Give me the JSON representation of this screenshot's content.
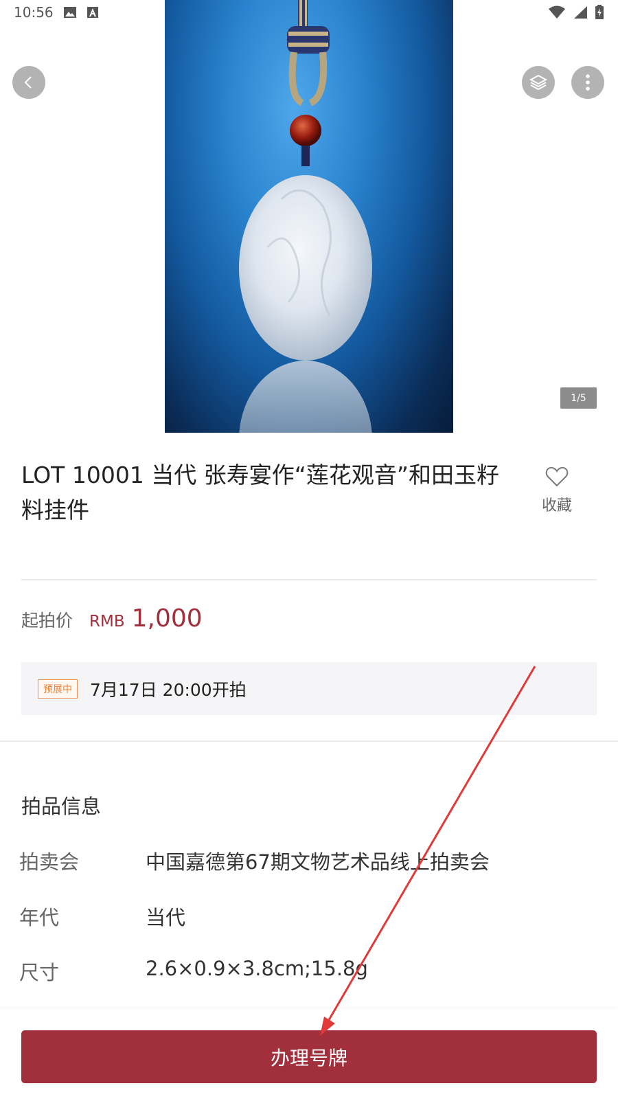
{
  "status_bar": {
    "time": "10:56",
    "icons": [
      "image-icon",
      "a-icon",
      "wifi-icon",
      "signal-icon",
      "battery-icon"
    ]
  },
  "header": {
    "back_icon": "chevron-left-icon",
    "layers_icon": "layers-icon",
    "more_icon": "more-vertical-icon"
  },
  "gallery": {
    "counter": "1/5"
  },
  "lot": {
    "title": "LOT 10001 当代  张寿宴作“莲花观音”和田玉籽料挂件",
    "favorite_label": "收藏",
    "favorite_icon": "heart-icon"
  },
  "price": {
    "label": "起拍价",
    "currency": "RMB",
    "value": "1,000"
  },
  "schedule": {
    "badge": "预展中",
    "text": "7月17日 20:00开拍"
  },
  "info": {
    "section_title": "拍品信息",
    "rows": [
      {
        "label": "拍卖会",
        "value": "中国嘉德第67期文物艺术品线上拍卖会"
      },
      {
        "label": "年代",
        "value": "当代"
      },
      {
        "label": "尺寸",
        "value": "2.6×0.9×3.8cm;15.8g"
      }
    ]
  },
  "cta": {
    "label": "办理号牌"
  },
  "colors": {
    "accent": "#a12f3c",
    "badge": "#e8803a",
    "annotation_arrow": "#e03a3a"
  }
}
